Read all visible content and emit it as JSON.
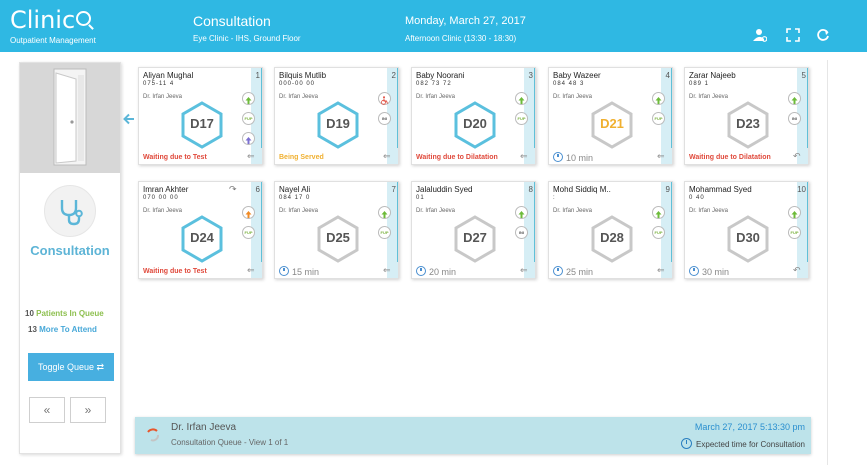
{
  "header": {
    "logo_text": "Clinic",
    "logo_subtitle": "Outpatient Management",
    "title": "Consultation",
    "subtitle": "Eye Clinic - IHS, Ground Floor",
    "date": "Monday, March 27, 2017",
    "session": "Afternoon Clinic (13:30 - 18:30)",
    "icons": [
      "user-settings-icon",
      "fullscreen-icon",
      "refresh-icon"
    ]
  },
  "sidebar": {
    "department": "Consultation",
    "queue_count": "10",
    "queue_label": "Patients In Queue",
    "attend_count": "13",
    "attend_label": "More To Attend",
    "toggle_label": "Toggle Queue",
    "prev_label": "«",
    "next_label": "»"
  },
  "cards": [
    {
      "name": "Aliyan Mughal",
      "num": "1",
      "mask": "075-11 4",
      "doctor": "Dr. Irfan Jeeva",
      "room": "D17",
      "status": "Waiting due to Test",
      "status_color": "#e04a3c",
      "wait": "",
      "hex_color": "#5bc0de",
      "room_color": "#555555",
      "chips": [
        "up",
        "FUP",
        "up-purple"
      ]
    },
    {
      "name": "Bilquis Mutlib",
      "num": "2",
      "mask": "000-00 00",
      "doctor": "Dr. Irfan Jeeva",
      "room": "D19",
      "status": "Being Served",
      "status_color": "#f0b030",
      "wait": "",
      "hex_color": "#5bc0de",
      "room_color": "#555555",
      "chips": [
        "wheelchair",
        "INI"
      ]
    },
    {
      "name": "Baby Noorani",
      "num": "3",
      "mask": "082 73 72",
      "doctor": "Dr. Irfan Jeeva",
      "room": "D20",
      "status": "Waiting due to Dilatation",
      "status_color": "#e04a3c",
      "wait": "",
      "hex_color": "#5bc0de",
      "room_color": "#555555",
      "chips": [
        "up",
        "FUP"
      ]
    },
    {
      "name": "Baby Wazeer",
      "num": "4",
      "mask": "084 48 3",
      "doctor": "Dr. Irfan Jeeva",
      "room": "D21",
      "status": "",
      "status_color": "",
      "wait": "10 min",
      "hex_color": "#c8c8c8",
      "room_color": "#f0b030",
      "chips": [
        "up",
        "FUP"
      ]
    },
    {
      "name": "Zarar Najeeb",
      "num": "5",
      "mask": "089 1",
      "doctor": "Dr. Irfan Jeeva",
      "room": "D23",
      "status": "Waiting due to Dilatation",
      "status_color": "#e04a3c",
      "wait": "",
      "hex_color": "#c8c8c8",
      "room_color": "#555555",
      "chips": [
        "up",
        "INI"
      ]
    },
    {
      "name": "Imran Akhter",
      "num": "6",
      "mask": "070 00 00",
      "doctor": "Dr. Irfan Jeeva",
      "room": "D24",
      "status": "Waiting due to Test",
      "status_color": "#e04a3c",
      "wait": "",
      "hex_color": "#5bc0de",
      "room_color": "#555555",
      "chips": [
        "up-orange",
        "FUP"
      ]
    },
    {
      "name": "Nayel Ali",
      "num": "7",
      "mask": "084 17 0",
      "doctor": "Dr. Irfan Jeeva",
      "room": "D25",
      "status": "",
      "status_color": "",
      "wait": "15 min",
      "hex_color": "#c8c8c8",
      "room_color": "#555555",
      "chips": [
        "up",
        "FUP"
      ]
    },
    {
      "name": "Jalaluddin Syed",
      "num": "8",
      "mask": "01",
      "doctor": "Dr. Irfan Jeeva",
      "room": "D27",
      "status": "",
      "status_color": "",
      "wait": "20 min",
      "hex_color": "#c8c8c8",
      "room_color": "#555555",
      "chips": [
        "up",
        "INI"
      ]
    },
    {
      "name": "Mohd Siddiq M..",
      "num": "9",
      "mask": ":",
      "doctor": "Dr. Irfan Jeeva",
      "room": "D28",
      "status": "",
      "status_color": "",
      "wait": "25 min",
      "hex_color": "#c8c8c8",
      "room_color": "#555555",
      "chips": [
        "up",
        "FUP"
      ]
    },
    {
      "name": "Mohammad Syed",
      "num": "10",
      "mask": "0 40",
      "doctor": "Dr. Irfan Jeeva",
      "room": "D30",
      "status": "",
      "status_color": "",
      "wait": "30 min",
      "hex_color": "#c8c8c8",
      "room_color": "#555555",
      "chips": [
        "up",
        "FUP"
      ]
    }
  ],
  "footer": {
    "doctor": "Dr. Irfan Jeeva",
    "view": "Consultation Queue - View 1 of 1",
    "datetime": "March 27, 2017 5:13:30 pm",
    "expected": "Expected time for Consultation"
  }
}
